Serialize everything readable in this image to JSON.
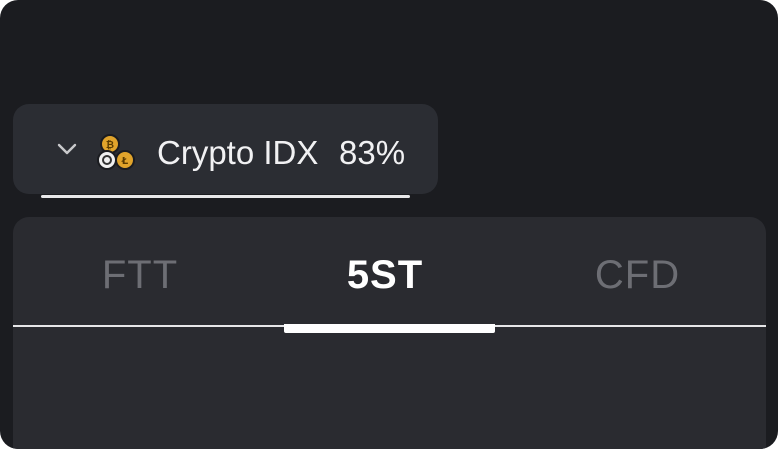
{
  "asset_selector": {
    "name": "Crypto IDX",
    "payout": "83%",
    "icon": "crypto-coins-icon",
    "chevron": "chevron-down-icon"
  },
  "tabs": [
    {
      "label": "FTT",
      "active": false
    },
    {
      "label": "5ST",
      "active": true
    },
    {
      "label": "CFD",
      "active": false
    }
  ],
  "colors": {
    "background": "#1b1c20",
    "pill": "#2b2d33",
    "panel": "#2a2b30",
    "active_text": "#ffffff",
    "inactive_text": "#6d6e74",
    "coin_gold": "#e0a32b"
  }
}
